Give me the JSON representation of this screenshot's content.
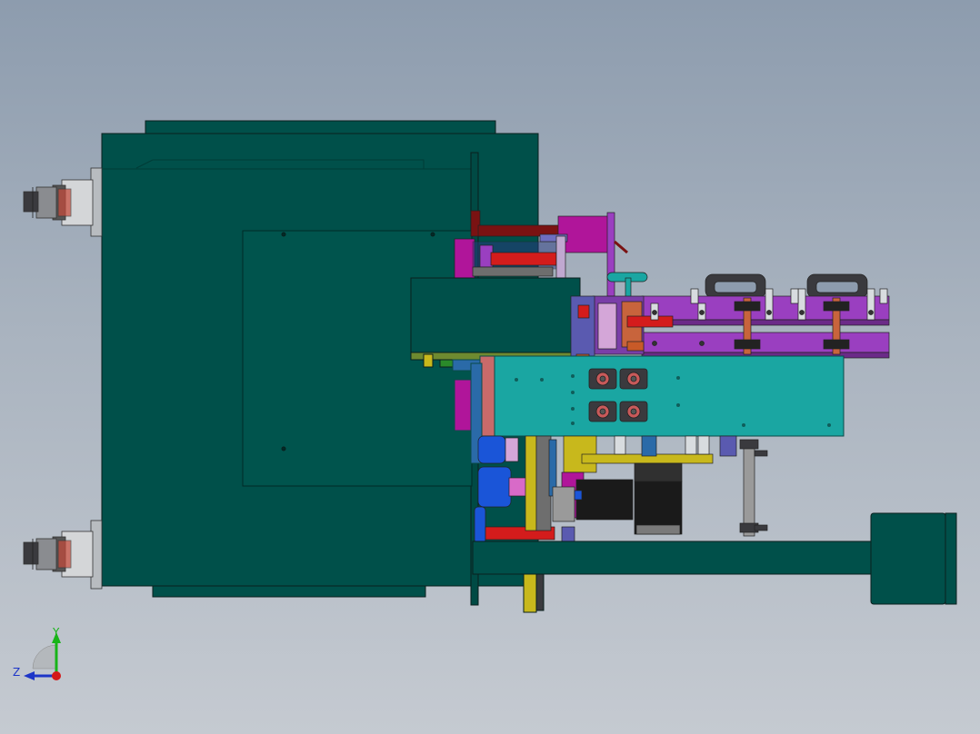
{
  "triad": {
    "y_label": "Y",
    "z_label": "Z",
    "colors": {
      "y_axis": "#18b418",
      "z_axis": "#1d35c8",
      "x_axis": "#d41818"
    }
  },
  "colors": {
    "background_top": "#8d9cae",
    "background_bottom": "#c5cad1",
    "housing_teal": "#00504a",
    "panel_cyan": "#1aa6a2",
    "bracket_purple": "#9a3fc0",
    "accent_magenta": "#b0159a",
    "cylinder_red": "#d41c1c",
    "motor_blue": "#1a55d8",
    "dark_red": "#7a1212",
    "yellow": "#c8b81c",
    "copper": "#c8643c",
    "motor_black": "#1a1a1a"
  }
}
